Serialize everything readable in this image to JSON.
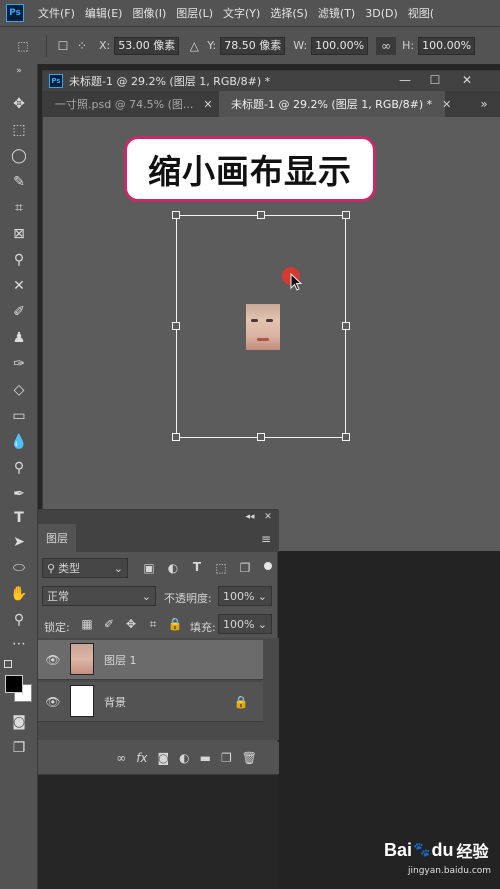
{
  "app": {
    "logo": "Ps"
  },
  "menu": [
    "文件(F)",
    "编辑(E)",
    "图像(I)",
    "图层(L)",
    "文字(Y)",
    "选择(S)",
    "滤镜(T)",
    "3D(D)",
    "视图("
  ],
  "options": {
    "x_label": "X:",
    "x_value": "53.00 像素",
    "y_label": "Y:",
    "y_value": "78.50 像素",
    "w_label": "W:",
    "w_value": "100.00%",
    "h_label": "H:",
    "h_value": "100.00%"
  },
  "document": {
    "title": "未标题-1 @ 29.2% (图层 1, RGB/8#) *",
    "tabs": [
      {
        "label": "一寸照.psd @ 74.5% (图...",
        "active": false
      },
      {
        "label": "未标题-1 @ 29.2% (图层 1, RGB/8#) *",
        "active": true
      }
    ]
  },
  "annotation": {
    "text": "缩小画布显示"
  },
  "layers_panel": {
    "tab": "图层",
    "filter_label": "类型",
    "blend_mode": "正常",
    "opacity_label": "不透明度:",
    "opacity_value": "100%",
    "lock_label": "锁定:",
    "fill_label": "填充:",
    "fill_value": "100%",
    "layers": [
      {
        "name": "图层 1",
        "selected": true
      },
      {
        "name": "背景",
        "selected": false,
        "locked": true
      }
    ],
    "footer_fx": "fx"
  },
  "colors": {
    "accent_border": "#c62a6b",
    "cursor_dot": "#d23a32",
    "ps_blue": "#31a8ff"
  },
  "watermark": {
    "brand": "Bai",
    "brand2": "du",
    "text": "经验",
    "url": "jingyan.baidu.com"
  }
}
